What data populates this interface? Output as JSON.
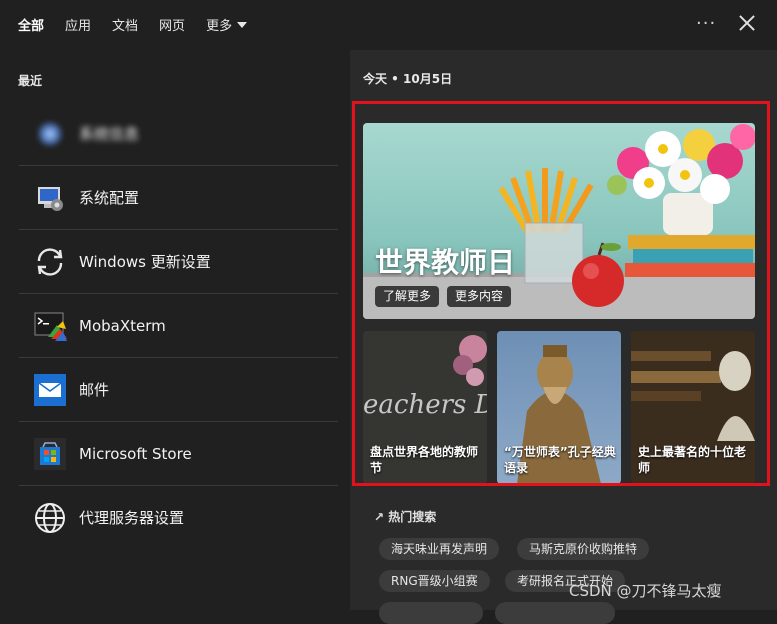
{
  "tabs": [
    "全部",
    "应用",
    "文档",
    "网页",
    "更多"
  ],
  "recent": {
    "title": "最近",
    "items": [
      {
        "label": "系统信息",
        "icon": "system-info-icon"
      },
      {
        "label": "系统配置",
        "icon": "system-config-icon"
      },
      {
        "label": "Windows 更新设置",
        "icon": "windows-update-icon"
      },
      {
        "label": "MobaXterm",
        "icon": "mobaxterm-icon"
      },
      {
        "label": "邮件",
        "icon": "mail-icon"
      },
      {
        "label": "Microsoft Store",
        "icon": "store-icon"
      },
      {
        "label": "代理服务器设置",
        "icon": "globe-icon"
      }
    ]
  },
  "highlights": {
    "date": "今天 • 10月5日",
    "hero": {
      "title": "世界教师日",
      "buttons": [
        "了解更多",
        "更多内容"
      ]
    },
    "cards": [
      {
        "text": "盘点世界各地的教师节",
        "chalk": "eachers DAY"
      },
      {
        "text": "“万世师表”孔子经典语录"
      },
      {
        "text": "史上最著名的十位老师"
      }
    ]
  },
  "hot": {
    "title": "热门搜索",
    "chips": [
      "海天味业再发声明",
      "马斯克原价收购推特",
      "RNG晋级小组赛",
      "考研报名正式开始"
    ]
  },
  "watermark": "CSDN @刀不锋马太瘦"
}
